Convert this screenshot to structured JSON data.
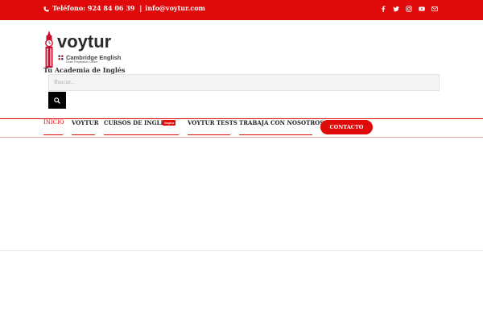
{
  "topbar": {
    "bg_color": "#e10a0a",
    "phone_icon": "phone-icon",
    "phone": "Teléfono: 924 84 06 39",
    "separator": "|",
    "email": "info@voytur.com",
    "social": [
      "facebook-icon",
      "twitter-icon",
      "instagram-icon",
      "youtube-icon",
      "mail-icon"
    ]
  },
  "logo": {
    "brand": "voytur",
    "cambridge": "Cambridge English",
    "cambridge_sub": "Exam Preparation Centre",
    "tagline": "Tu Academia de Inglés"
  },
  "search": {
    "placeholder": "Buscar...",
    "button_icon": "search-icon"
  },
  "nav": {
    "items": [
      {
        "label": "INICIO",
        "active": true
      },
      {
        "label": "VOYTUR"
      },
      {
        "label": "CURSOS DE INGLES",
        "badge": "Voytur"
      },
      {
        "label": "VOYTUR TESTS"
      },
      {
        "label": "TRABAJA CON NOSOTROS"
      }
    ],
    "contact_button": "CONTACTO"
  },
  "accent_color": "#e10a0a"
}
